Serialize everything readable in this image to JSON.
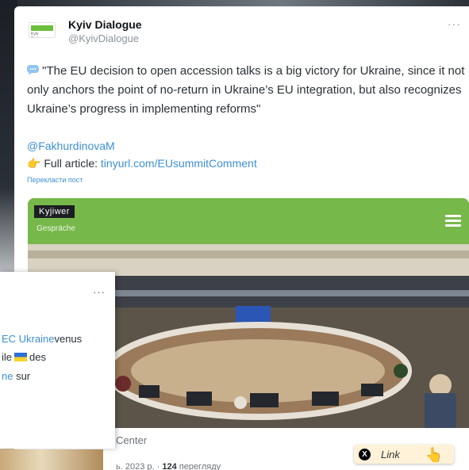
{
  "tweet": {
    "display_name": "Kyiv Dialogue",
    "handle": "@KyivDialogue",
    "avatar_text": "Kyiv Dialogue",
    "more_label": "···",
    "text": "\"The EU decision to open accession talks is a big victory for Ukraine, since it not only anchors the point of no-return in Ukraine’s EU integration, but also recognizes Ukraine’s progress in implementing reforms\"",
    "mention": "@FakhurdinovaM",
    "article_prefix": "Full article:",
    "article_link": "tinyurl.com/EUsummitComment",
    "translate_label": "Перекласти пост",
    "caption": "Center",
    "date_fragment": "ь. 2023 р.",
    "views_count": "124",
    "views_label": "перегляду"
  },
  "media": {
    "brand": "Kyjiwer",
    "brand_sub": "Gespräche"
  },
  "overlay_card": {
    "more_label": "···",
    "line1_tag": "EC Ukraine",
    "line1_text": "venus",
    "line2_before": "ile",
    "line2_after": "des",
    "line3_tag": "ne",
    "line3_text": " sur"
  },
  "link_badge": {
    "label": "Link"
  },
  "icons": {
    "speech": "speech-bubble-icon",
    "hand": "pointing-hand-icon",
    "x_logo": "x-logo-icon"
  },
  "colors": {
    "link": "#3d8fd6",
    "media_header": "#77b84a",
    "badge_bg": "#fff2d9"
  }
}
